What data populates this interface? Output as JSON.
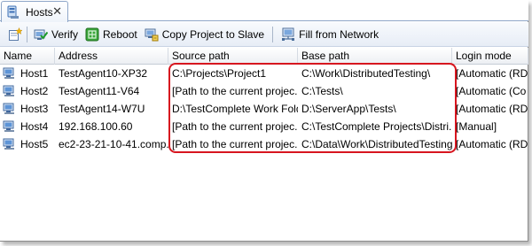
{
  "tab": {
    "title": "Hosts",
    "close_glyph": "✕"
  },
  "toolbar": {
    "verify_label": "Verify",
    "reboot_label": "Reboot",
    "copy_label": "Copy Project to Slave",
    "fill_label": "Fill from Network"
  },
  "grid": {
    "columns": [
      "Name",
      "Address",
      "Source path",
      "Base path",
      "Login mode"
    ],
    "rows": [
      {
        "name": "Host1",
        "address": "TestAgent10-XP32",
        "source": "C:\\Projects\\Project1",
        "base": "C:\\Work\\DistributedTesting\\",
        "login": "[Automatic (RD"
      },
      {
        "name": "Host2",
        "address": "TestAgent11-V64",
        "source": "[Path to the current projec...",
        "base": "C:\\Tests\\",
        "login": "[Automatic (Co"
      },
      {
        "name": "Host3",
        "address": "TestAgent14-W7U",
        "source": "D:\\TestComplete Work Fold...",
        "base": "D:\\ServerApp\\Tests\\",
        "login": "[Automatic (RD"
      },
      {
        "name": "Host4",
        "address": "192.168.100.60",
        "source": "[Path to the current projec...",
        "base": "C:\\TestComplete Projects\\Distri...",
        "login": "[Manual]"
      },
      {
        "name": "Host5",
        "address": "ec2-23-21-10-41.comp...",
        "source": "[Path to the current projec...",
        "base": "C:\\Data\\Work\\DistributedTesting\\",
        "login": "[Automatic (RDP"
      }
    ]
  },
  "colors": {
    "highlight": "#d7161f",
    "tab_border": "#8ea6c8"
  }
}
